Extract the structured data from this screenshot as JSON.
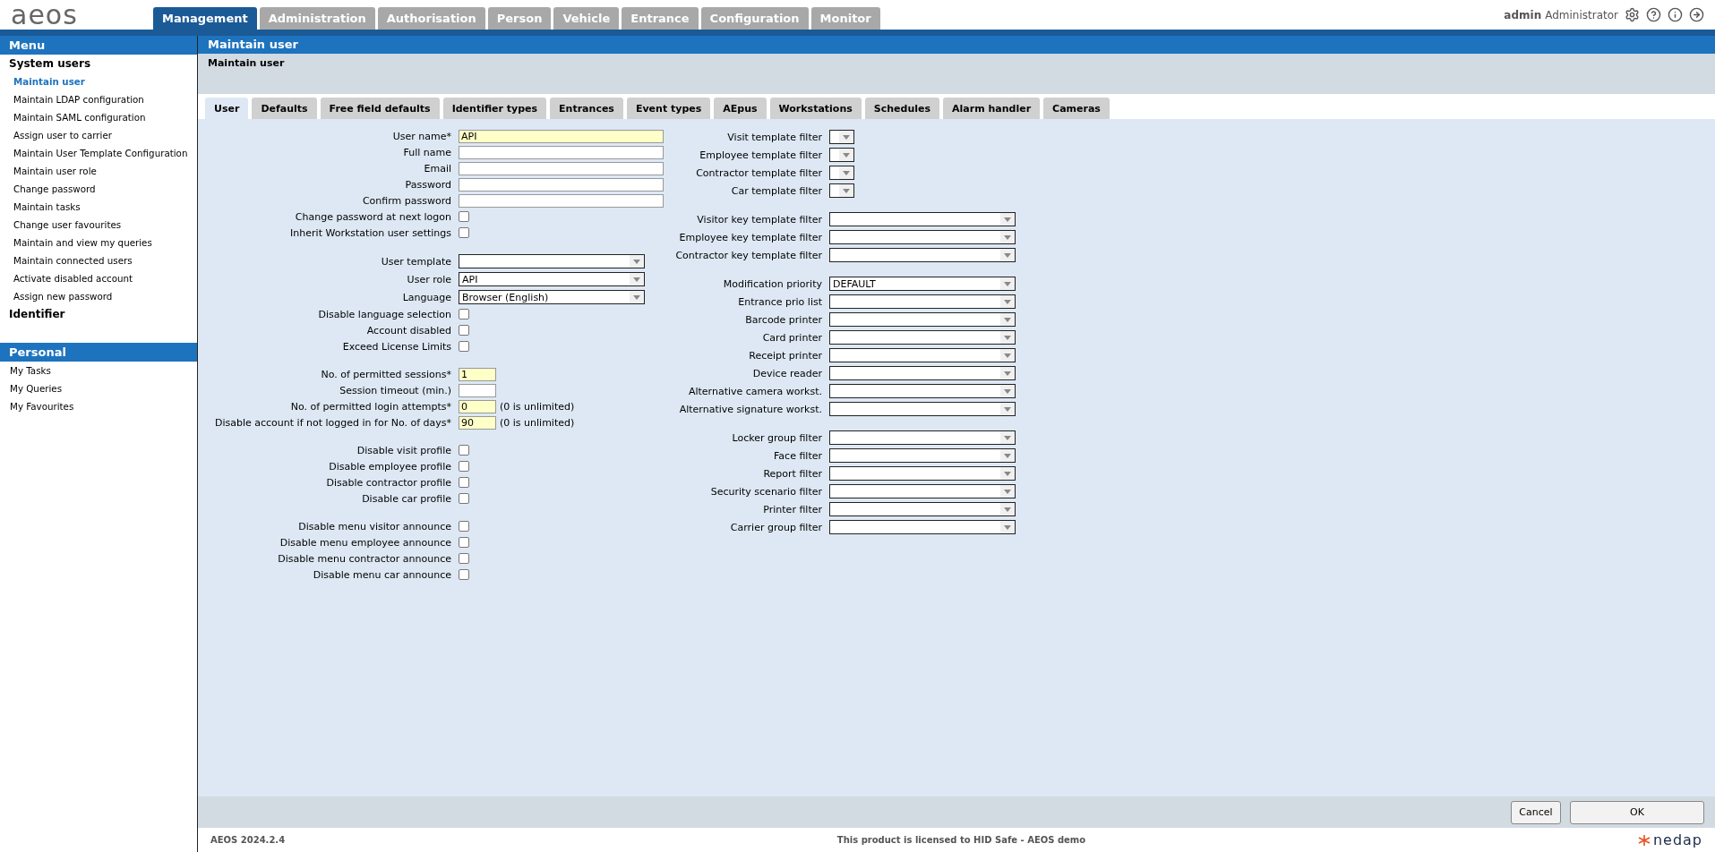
{
  "header": {
    "logo": "aeos",
    "user_name": "admin",
    "user_role": "Administrator"
  },
  "top_tabs": [
    {
      "label": "Management",
      "selected": true
    },
    {
      "label": "Administration",
      "selected": false
    },
    {
      "label": "Authorisation",
      "selected": false
    },
    {
      "label": "Person",
      "selected": false
    },
    {
      "label": "Vehicle",
      "selected": false
    },
    {
      "label": "Entrance",
      "selected": false
    },
    {
      "label": "Configuration",
      "selected": false
    },
    {
      "label": "Monitor",
      "selected": false
    }
  ],
  "sidebar": [
    {
      "title": "Menu",
      "groups": [
        {
          "label": "System users",
          "children": [
            {
              "label": "Maintain user",
              "selected": true
            },
            {
              "label": "Maintain LDAP configuration",
              "selected": false
            },
            {
              "label": "Maintain SAML configuration",
              "selected": false
            },
            {
              "label": "Assign user to carrier",
              "selected": false
            },
            {
              "label": "Maintain User Template Configuration",
              "selected": false
            },
            {
              "label": "Maintain user role",
              "selected": false
            },
            {
              "label": "Change password",
              "selected": false
            },
            {
              "label": "Maintain tasks",
              "selected": false
            },
            {
              "label": "Change user favourites",
              "selected": false
            },
            {
              "label": "Maintain and view my queries",
              "selected": false
            },
            {
              "label": "Maintain connected users",
              "selected": false
            },
            {
              "label": "Activate disabled account",
              "selected": false
            },
            {
              "label": "Assign new password",
              "selected": false
            }
          ]
        },
        {
          "label": "Identifier"
        }
      ]
    },
    {
      "title": "Personal",
      "items": [
        {
          "label": "My Tasks",
          "selected": false
        },
        {
          "label": "My Queries",
          "selected": false
        },
        {
          "label": "My Favourites",
          "selected": false
        }
      ]
    }
  ],
  "page_title": "Maintain user",
  "subtitle": "Maintain user",
  "tabs": [
    {
      "label": "User",
      "selected": true
    },
    {
      "label": "Defaults",
      "selected": false
    },
    {
      "label": "Free field defaults",
      "selected": false
    },
    {
      "label": "Identifier types",
      "selected": false
    },
    {
      "label": "Entrances",
      "selected": false
    },
    {
      "label": "Event types",
      "selected": false
    },
    {
      "label": "AEpus",
      "selected": false
    },
    {
      "label": "Workstations",
      "selected": false
    },
    {
      "label": "Schedules",
      "selected": false
    },
    {
      "label": "Alarm handler",
      "selected": false
    },
    {
      "label": "Cameras",
      "selected": false
    }
  ],
  "left_groups": [
    [
      {
        "kind": "text",
        "label": "User name*",
        "value": "API",
        "mandatory": true
      },
      {
        "kind": "text",
        "label": "Full name",
        "mandatory": false
      },
      {
        "kind": "text",
        "label": "Email",
        "mandatory": false
      },
      {
        "kind": "text",
        "label": "Password",
        "mandatory": false
      },
      {
        "kind": "text",
        "label": "Confirm password",
        "mandatory": false
      },
      {
        "kind": "checkbox",
        "label": "Change password at next logon",
        "checked": false
      },
      {
        "kind": "checkbox",
        "label": "Inherit Workstation user settings",
        "checked": false
      }
    ],
    [
      {
        "kind": "select",
        "label": "User template"
      },
      {
        "kind": "select",
        "label": "User role",
        "value": "API"
      },
      {
        "kind": "select",
        "label": "Language",
        "value": "Browser (English)"
      },
      {
        "kind": "checkbox",
        "label": "Disable language selection",
        "checked": false
      },
      {
        "kind": "checkbox",
        "label": "Account disabled",
        "checked": false
      },
      {
        "kind": "checkbox",
        "label": "Exceed License Limits",
        "checked": false
      }
    ],
    [
      {
        "kind": "number",
        "label": "No. of permitted sessions*",
        "value": "1",
        "mandatory": true
      },
      {
        "kind": "number",
        "label": "Session timeout (min.)",
        "mandatory": false
      },
      {
        "kind": "number",
        "label": "No. of permitted login attempts*",
        "value": "0",
        "mandatory": true,
        "hint": "(0 is unlimited)"
      },
      {
        "kind": "number",
        "label": "Disable account if not logged in for No. of days*",
        "value": "90",
        "mandatory": true,
        "hint": "(0 is unlimited)"
      }
    ],
    [
      {
        "kind": "checkbox",
        "label": "Disable visit profile",
        "checked": false
      },
      {
        "kind": "checkbox",
        "label": "Disable employee profile",
        "checked": false
      },
      {
        "kind": "checkbox",
        "label": "Disable contractor profile",
        "checked": false
      },
      {
        "kind": "checkbox",
        "label": "Disable car profile",
        "checked": false
      }
    ],
    [
      {
        "kind": "checkbox",
        "label": "Disable menu visitor announce",
        "checked": false
      },
      {
        "kind": "checkbox",
        "label": "Disable menu employee announce",
        "checked": false
      },
      {
        "kind": "checkbox",
        "label": "Disable menu contractor announce",
        "checked": false
      },
      {
        "kind": "checkbox",
        "label": "Disable menu car announce",
        "checked": false
      }
    ]
  ],
  "right_groups": [
    [
      {
        "kind": "mini-select",
        "label": "Visit template filter"
      },
      {
        "kind": "mini-select",
        "label": "Employee template filter"
      },
      {
        "kind": "mini-select",
        "label": "Contractor template filter"
      },
      {
        "kind": "mini-select",
        "label": "Car template filter"
      }
    ],
    [
      {
        "kind": "select",
        "label": "Visitor key template filter"
      },
      {
        "kind": "select",
        "label": "Employee key template filter"
      },
      {
        "kind": "select",
        "label": "Contractor key template filter"
      }
    ],
    [
      {
        "kind": "select",
        "label": "Modification priority",
        "value": "DEFAULT"
      },
      {
        "kind": "select",
        "label": "Entrance prio list"
      },
      {
        "kind": "select",
        "label": "Barcode printer"
      },
      {
        "kind": "select",
        "label": "Card printer"
      },
      {
        "kind": "select",
        "label": "Receipt printer"
      },
      {
        "kind": "select",
        "label": "Device reader"
      },
      {
        "kind": "select",
        "label": "Alternative camera workst."
      },
      {
        "kind": "select",
        "label": "Alternative signature workst."
      }
    ],
    [
      {
        "kind": "select",
        "label": "Locker group filter"
      },
      {
        "kind": "select",
        "label": "Face filter"
      },
      {
        "kind": "select",
        "label": "Report filter"
      },
      {
        "kind": "select",
        "label": "Security scenario filter"
      },
      {
        "kind": "select",
        "label": "Printer filter"
      },
      {
        "kind": "select",
        "label": "Carrier group filter"
      }
    ]
  ],
  "buttons": [
    "Cancel",
    "OK"
  ],
  "footer": {
    "version": "AEOS 2024.2.4",
    "license": "This product is licensed to HID Safe - AEOS demo",
    "brand": "nedap"
  }
}
